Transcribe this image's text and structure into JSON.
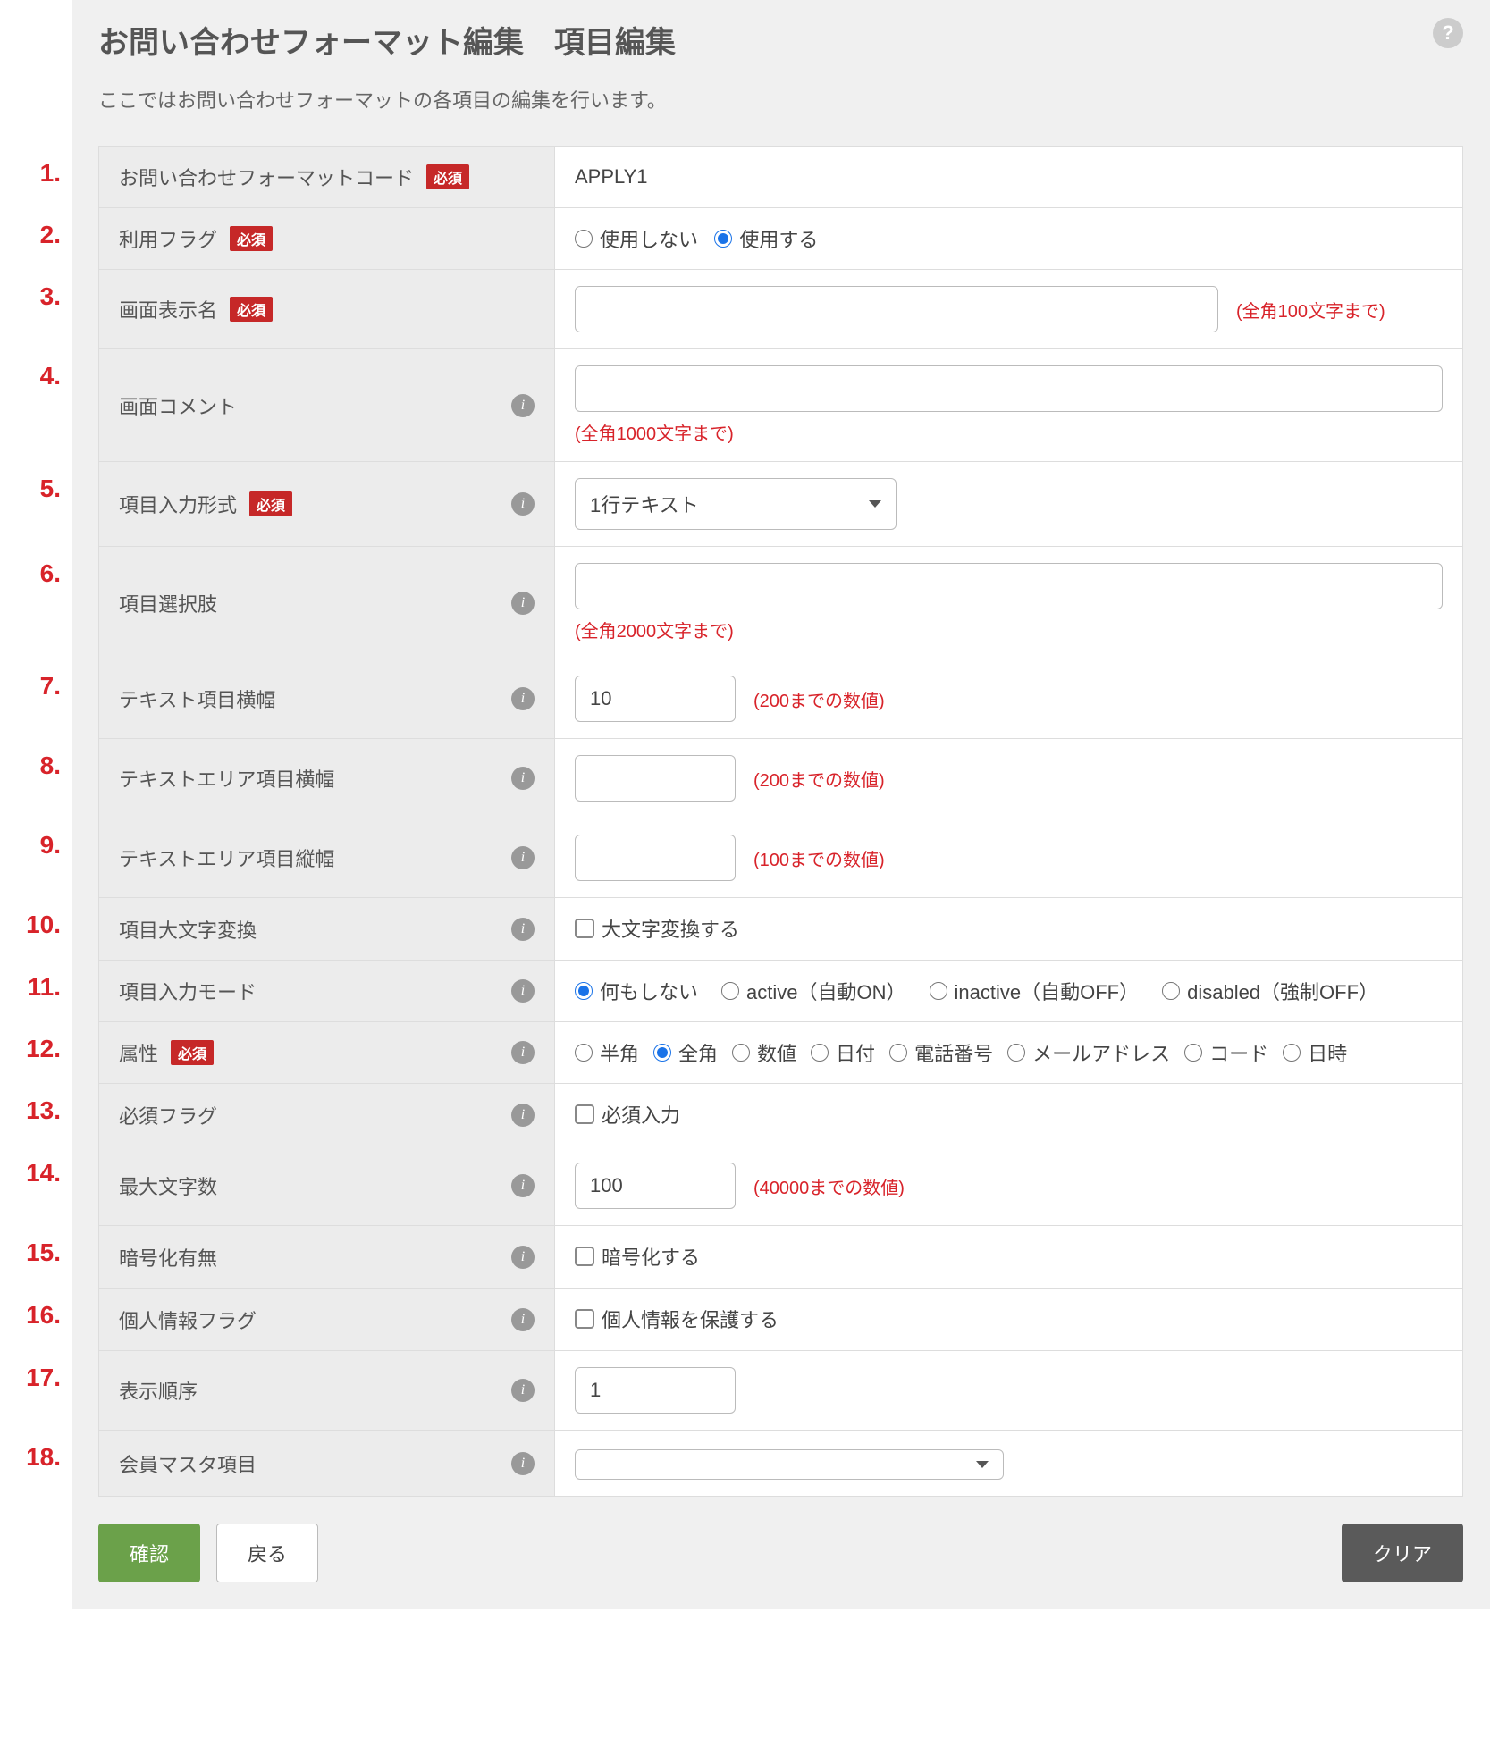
{
  "header": {
    "title": "お問い合わせフォーマット編集　項目編集",
    "description": "ここではお問い合わせフォーマットの各項目の編集を行います。",
    "help_label": "?"
  },
  "required_badge": "必須",
  "fields": {
    "format_code": {
      "label": "お問い合わせフォーマットコード",
      "value": "APPLY1"
    },
    "use_flag": {
      "label": "利用フラグ",
      "option_off": "使用しない",
      "option_on": "使用する"
    },
    "display_name": {
      "label": "画面表示名",
      "value": "",
      "hint": "(全角100文字まで)"
    },
    "screen_comment": {
      "label": "画面コメント",
      "value": "",
      "hint": "(全角1000文字まで)"
    },
    "input_type": {
      "label": "項目入力形式",
      "selected": "1行テキスト"
    },
    "choices": {
      "label": "項目選択肢",
      "value": "",
      "hint": "(全角2000文字まで)"
    },
    "text_width": {
      "label": "テキスト項目横幅",
      "value": "10",
      "hint": "(200までの数値)"
    },
    "textarea_width": {
      "label": "テキストエリア項目横幅",
      "value": "",
      "hint": "(200までの数値)"
    },
    "textarea_height": {
      "label": "テキストエリア項目縦幅",
      "value": "",
      "hint": "(100までの数値)"
    },
    "uppercase": {
      "label": "項目大文字変換",
      "option": "大文字変換する"
    },
    "input_mode": {
      "label": "項目入力モード",
      "options": {
        "none": "何もしない",
        "active": "active（自動ON）",
        "inactive": "inactive（自動OFF）",
        "disabled": "disabled（強制OFF）"
      }
    },
    "attribute": {
      "label": "属性",
      "options": {
        "half": "半角",
        "full": "全角",
        "num": "数値",
        "date": "日付",
        "tel": "電話番号",
        "mail": "メールアドレス",
        "code": "コード",
        "datetime": "日時"
      }
    },
    "required_flag": {
      "label": "必須フラグ",
      "option": "必須入力"
    },
    "max_len": {
      "label": "最大文字数",
      "value": "100",
      "hint": "(40000までの数値)"
    },
    "encrypt": {
      "label": "暗号化有無",
      "option": "暗号化する"
    },
    "pii": {
      "label": "個人情報フラグ",
      "option": "個人情報を保護する"
    },
    "order": {
      "label": "表示順序",
      "value": "1"
    },
    "member_master": {
      "label": "会員マスタ項目",
      "selected": ""
    }
  },
  "buttons": {
    "confirm": "確認",
    "back": "戻る",
    "clear": "クリア"
  },
  "markers": [
    "1.",
    "2.",
    "3.",
    "4.",
    "5.",
    "6.",
    "7.",
    "8.",
    "9.",
    "10.",
    "11.",
    "12.",
    "13.",
    "14.",
    "15.",
    "16.",
    "17.",
    "18."
  ]
}
